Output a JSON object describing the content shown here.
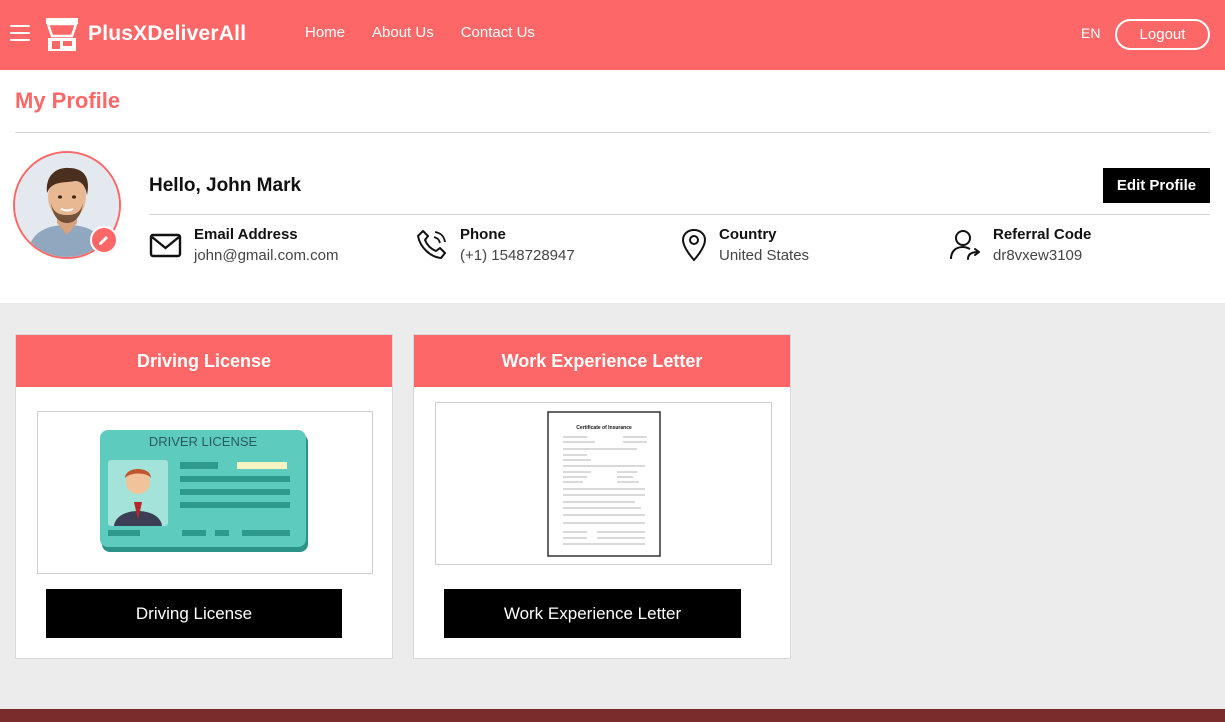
{
  "header": {
    "brand": "PlusXDeliverAll",
    "nav": [
      "Home",
      "About Us",
      "Contact Us"
    ],
    "language": "EN",
    "logout_label": "Logout"
  },
  "profile": {
    "title": "My Profile",
    "greeting": "Hello, John Mark",
    "edit_label": "Edit Profile",
    "email": {
      "label": "Email Address",
      "value": "john@gmail.com.com",
      "icon": "envelope-icon"
    },
    "phone": {
      "label": "Phone",
      "value": "(+1) 1548728947",
      "icon": "phone-icon"
    },
    "country": {
      "label": "Country",
      "value": "United States",
      "icon": "location-pin-icon"
    },
    "referral": {
      "label": "Referral Code",
      "value": "dr8vxew3109",
      "icon": "user-share-icon"
    }
  },
  "documents": [
    {
      "title": "Driving License",
      "button": "Driving License",
      "card_text": "DRIVER LICENSE"
    },
    {
      "title": "Work Experience Letter",
      "button": "Work Experience Letter",
      "doc_heading": "Certificate of Insurance"
    }
  ],
  "colors": {
    "accent": "#fd6767",
    "footer": "#7a2b2b",
    "button": "#000000"
  }
}
